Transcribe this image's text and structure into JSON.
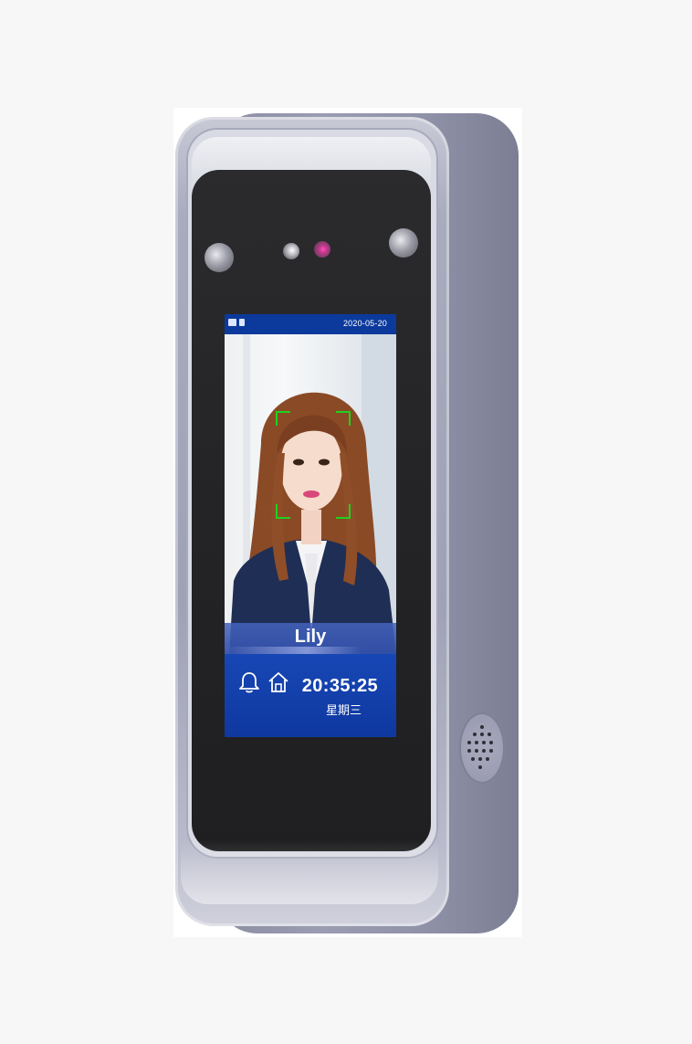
{
  "device": {
    "type": "face-recognition-access-terminal",
    "accent_color": "#0b3a9c",
    "frame_color": "#1fd11f",
    "pink_sensor_color": "#ff4fb8"
  },
  "screen": {
    "status_bar": {
      "date": "2020-05-20",
      "icons": [
        "network-icon",
        "battery-icon"
      ]
    },
    "recognition": {
      "person_name": "Lily",
      "face_frame_color": "#1fd11f"
    },
    "footer": {
      "time": "20:35:25",
      "weekday": "星期三",
      "icons": [
        "bell-icon",
        "home-icon"
      ]
    }
  }
}
